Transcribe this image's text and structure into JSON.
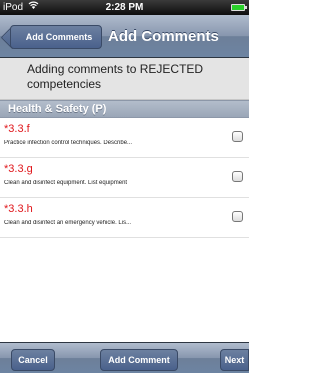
{
  "status_bar": {
    "carrier": "iPod",
    "time": "2:28 PM"
  },
  "nav": {
    "back_label": "Add Comments",
    "title": "Add Comments"
  },
  "message": {
    "line1": "Adding comments to REJECTED",
    "line2": "competencies"
  },
  "section": {
    "title": "Health & Safety (P)"
  },
  "items": [
    {
      "code": "*3.3.f",
      "description": "Practice infection control techniques. Describe..."
    },
    {
      "code": "*3.3.g",
      "description": "Clean and disinfect equipment.  List equipment"
    },
    {
      "code": "*3.3.h",
      "description": "Clean and disinfect an emergency vehicle.  Lis..."
    }
  ],
  "toolbar": {
    "cancel_label": "Cancel",
    "add_label": "Add Comment",
    "next_label": "Next"
  },
  "colors": {
    "code_red": "#e0161b",
    "nav_blue": "#6d84a2"
  }
}
